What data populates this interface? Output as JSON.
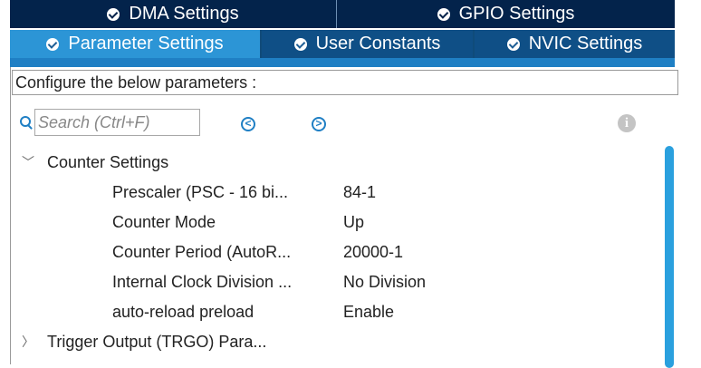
{
  "tabs_row1": [
    {
      "label": "DMA Settings"
    },
    {
      "label": "GPIO Settings"
    }
  ],
  "tabs_row2": [
    {
      "label": "Parameter Settings",
      "active": true
    },
    {
      "label": "User Constants"
    },
    {
      "label": "NVIC Settings"
    }
  ],
  "config_label": "Configure the below parameters :",
  "search": {
    "placeholder": "Search (Ctrl+F)"
  },
  "nav": {
    "prev": "<",
    "next": ">"
  },
  "info": "i",
  "tree": {
    "group1": {
      "label": "Counter Settings",
      "expanded": true
    },
    "params": [
      {
        "name": "Prescaler (PSC - 16 bi...",
        "value": "84-1"
      },
      {
        "name": "Counter Mode",
        "value": "Up"
      },
      {
        "name": "Counter Period (AutoR...",
        "value": "20000-1"
      },
      {
        "name": "Internal Clock Division ...",
        "value": "No Division"
      },
      {
        "name": "auto-reload preload",
        "value": "Enable"
      }
    ],
    "group2": {
      "label": "Trigger Output (TRGO) Para...",
      "expanded": false
    }
  },
  "colors": {
    "tab_dark": "#03234b",
    "tab_active": "#2c95d6",
    "accent": "#1f7fc4"
  }
}
